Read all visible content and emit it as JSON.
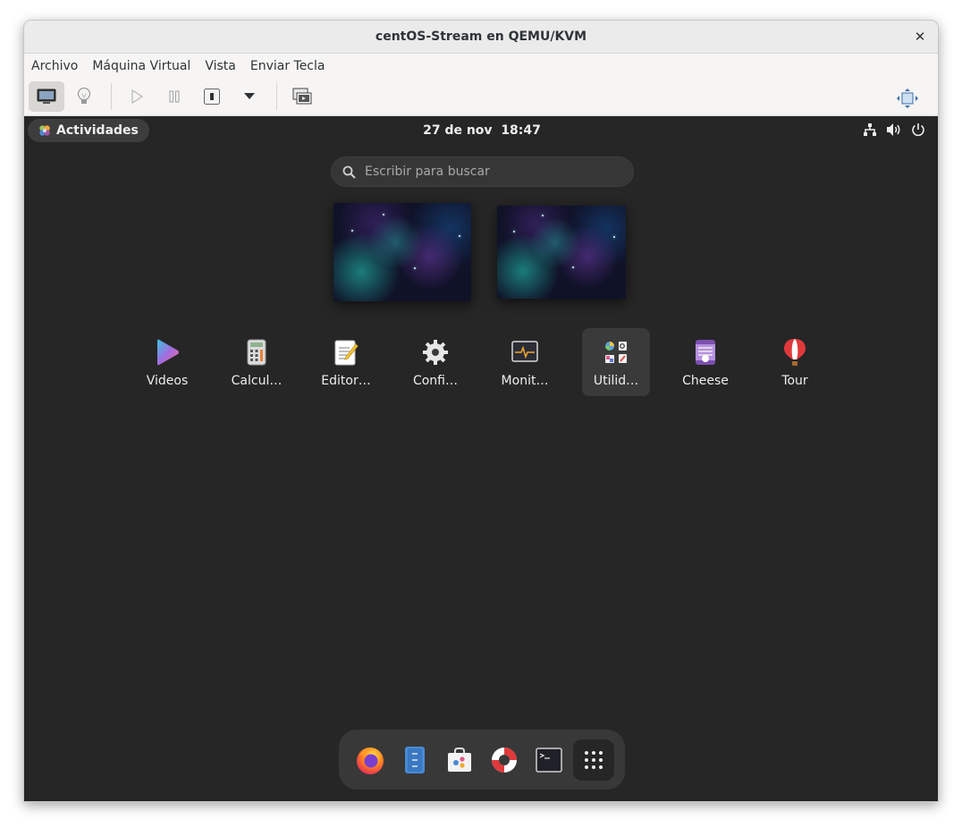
{
  "window": {
    "title": "centOS-Stream en QEMU/KVM",
    "close_glyph": "✕"
  },
  "menubar": {
    "items": [
      "Archivo",
      "Máquina Virtual",
      "Vista",
      "Enviar Tecla"
    ]
  },
  "toolbar": {
    "buttons": [
      "display-console-icon",
      "details-lightbulb-icon",
      "run-play-icon",
      "pause-icon",
      "shutdown-icon",
      "shutdown-menu-chevron-icon",
      "snapshot-manager-icon"
    ],
    "right_button": "resize-to-vm-icon"
  },
  "guest": {
    "topbar": {
      "activities_label": "Actividades",
      "date": "27 de nov",
      "time": "18:47",
      "tray_icons": [
        "network-wired-icon",
        "volume-icon",
        "power-icon"
      ]
    },
    "search": {
      "placeholder": "Escribir para buscar"
    },
    "apps": [
      {
        "label": "Videos",
        "icon": "videos-icon"
      },
      {
        "label": "Calcul…",
        "icon": "calculator-icon"
      },
      {
        "label": "Editor…",
        "icon": "text-editor-icon"
      },
      {
        "label": "Confi…",
        "icon": "settings-gear-icon"
      },
      {
        "label": "Monit…",
        "icon": "system-monitor-icon"
      },
      {
        "label": "Utilid…",
        "icon": "utilities-folder-icon"
      },
      {
        "label": "Cheese",
        "icon": "cheese-icon"
      },
      {
        "label": "Tour",
        "icon": "tour-balloon-icon"
      }
    ],
    "dash": [
      "firefox-icon",
      "files-icon",
      "software-icon",
      "help-lifebuoy-icon",
      "terminal-icon",
      "show-apps-grid-icon"
    ]
  },
  "colors": {
    "guest_bg": "#262626",
    "dash_bg": "#383838",
    "hover_bg": "#3a3a3a",
    "text": "#eeeeec"
  }
}
